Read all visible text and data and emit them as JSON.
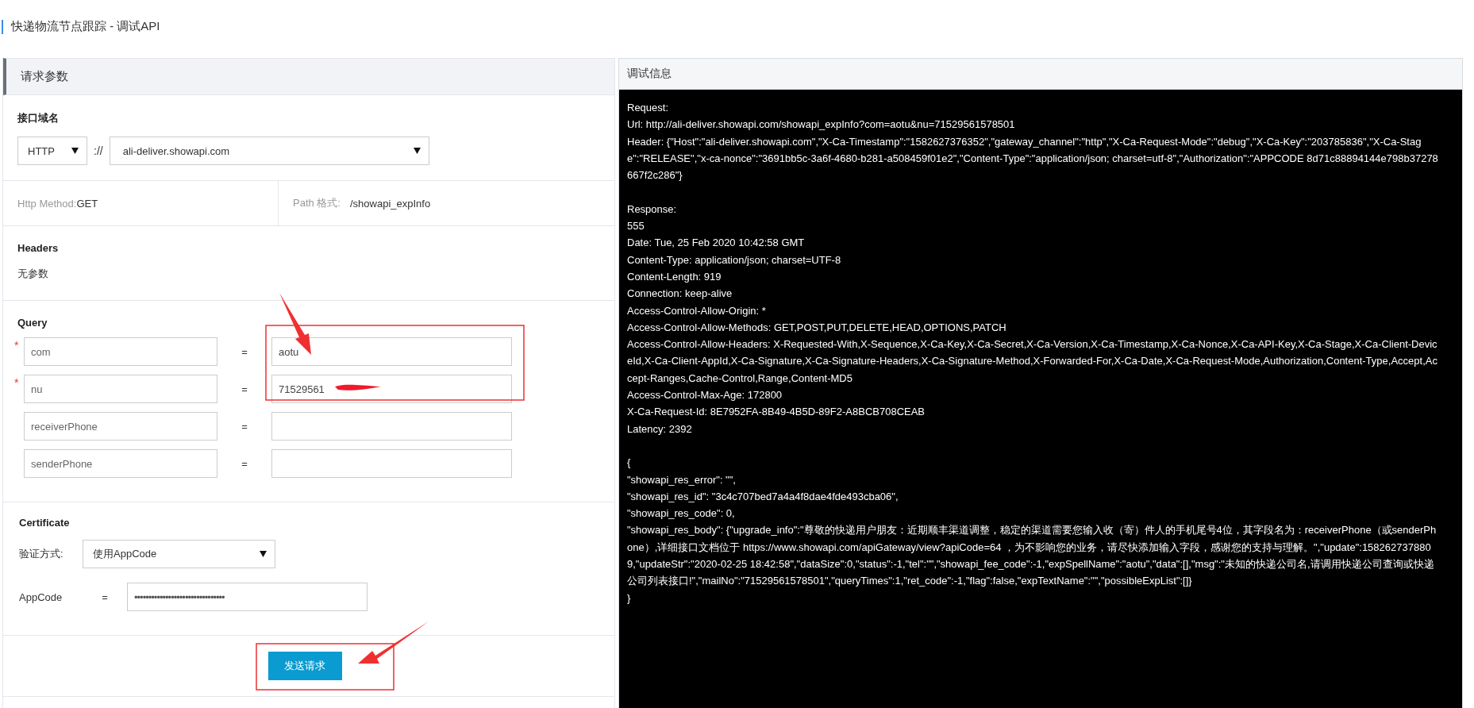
{
  "page_title": "快递物流节点跟踪 - 调试API",
  "request_panel": {
    "title": "请求参数",
    "domain": {
      "label": "接口域名",
      "protocol": "HTTP",
      "separator": "://",
      "host": "ali-deliver.showapi.com"
    },
    "method": {
      "label": "Http Method:",
      "value": "GET"
    },
    "path": {
      "label": "Path 格式:",
      "value": "/showapi_expInfo"
    },
    "headers": {
      "title": "Headers",
      "note": "无参数"
    },
    "query": {
      "title": "Query",
      "required_marker": "*",
      "params": [
        {
          "name": "com",
          "required": true,
          "equals": "=",
          "value": "aotu",
          "redacted": false
        },
        {
          "name": "nu",
          "required": true,
          "equals": "=",
          "value": "71529561",
          "redacted": true
        },
        {
          "name": "receiverPhone",
          "required": false,
          "equals": "="
        },
        {
          "name": "senderPhone",
          "required": false,
          "equals": "="
        }
      ]
    },
    "certificate": {
      "title": "Certificate",
      "auth_label": "验证方式:",
      "auth_method": "使用AppCode",
      "appcode_label": "AppCode",
      "equals": "=",
      "appcode_value": "••••••••••••••••••••••••••••••••"
    },
    "send_button": "发送请求"
  },
  "debug_panel": {
    "title": "调试信息",
    "blocks": [
      [
        "Request:",
        "Url: http://ali-deliver.showapi.com/showapi_expInfo?com=aotu&nu=71529561578501",
        "Header: {\"Host\":\"ali-deliver.showapi.com\",\"X-Ca-Timestamp\":\"1582627376352\",\"gateway_channel\":\"http\",\"X-Ca-Request-Mode\":\"debug\",\"X-Ca-Key\":\"203785836\",\"X-Ca-Stage\":\"RELEASE\",\"x-ca-nonce\":\"3691bb5c-3a6f-4680-b281-a508459f01e2\",\"Content-Type\":\"application/json; charset=utf-8\",\"Authorization\":\"APPCODE 8d71c88894144e798b37278667f2c286\"}"
      ],
      [
        "Response:",
        "555",
        "Date: Tue, 25 Feb 2020 10:42:58 GMT",
        "Content-Type: application/json; charset=UTF-8",
        "Content-Length: 919",
        "Connection: keep-alive",
        "Access-Control-Allow-Origin: *",
        "Access-Control-Allow-Methods: GET,POST,PUT,DELETE,HEAD,OPTIONS,PATCH",
        "Access-Control-Allow-Headers: X-Requested-With,X-Sequence,X-Ca-Key,X-Ca-Secret,X-Ca-Version,X-Ca-Timestamp,X-Ca-Nonce,X-Ca-API-Key,X-Ca-Stage,X-Ca-Client-DeviceId,X-Ca-Client-AppId,X-Ca-Signature,X-Ca-Signature-Headers,X-Ca-Signature-Method,X-Forwarded-For,X-Ca-Date,X-Ca-Request-Mode,Authorization,Content-Type,Accept,Accept-Ranges,Cache-Control,Range,Content-MD5",
        "Access-Control-Max-Age: 172800",
        "X-Ca-Request-Id: 8E7952FA-8B49-4B5D-89F2-A8BCB708CEAB",
        "Latency: 2392"
      ],
      [
        "{",
        "\"showapi_res_error\": \"\",",
        "\"showapi_res_id\": \"3c4c707bed7a4a4f8dae4fde493cba06\",",
        "\"showapi_res_code\": 0,",
        "\"showapi_res_body\": {\"upgrade_info\":\"尊敬的快递用户朋友：近期顺丰渠道调整，稳定的渠道需要您输入收（寄）件人的手机尾号4位，其字段名为：receiverPhone（或senderPhone）,详细接口文档位于 https://www.showapi.com/apiGateway/view?apiCode=64 ，为不影响您的业务，请尽快添加输入字段，感谢您的支持与理解。\",\"update\":1582627378809,\"updateStr\":\"2020-02-25 18:42:58\",\"dataSize\":0,\"status\":-1,\"tel\":\"\",\"showapi_fee_code\":-1,\"expSpellName\":\"aotu\",\"data\":[],\"msg\":\"未知的快递公司名,请调用快递公司查询或快递公司列表接口!\",\"mailNo\":\"71529561578501\",\"queryTimes\":1,\"ret_code\":-1,\"flag\":false,\"expTextName\":\"\",\"possibleExpList\":[]}",
        "}"
      ]
    ]
  }
}
